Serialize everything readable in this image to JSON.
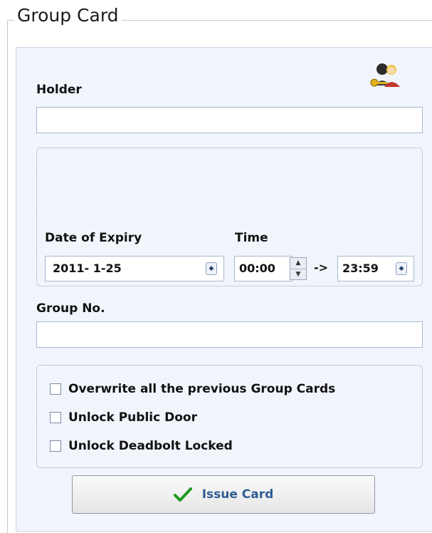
{
  "group": {
    "title": "Group Card"
  },
  "holder": {
    "label": "Holder",
    "value": ""
  },
  "expiry": {
    "date_label": "Date of Expiry",
    "time_label": "Time",
    "date_value": "2011- 1-25",
    "time_start": "00:00",
    "arrow": "->",
    "time_end": "23:59"
  },
  "group_no": {
    "label": "Group No.",
    "value": ""
  },
  "options": [
    {
      "label": "Overwrite all the previous Group Cards",
      "checked": false
    },
    {
      "label": "Unlock Public Door",
      "checked": false
    },
    {
      "label": "Unlock Deadbolt Locked",
      "checked": false
    }
  ],
  "issue_button": {
    "label": "Issue Card",
    "accent": "#1e9a1e"
  },
  "icons": {
    "group": "group-users-key-icon",
    "spin": "spin-icon",
    "check": "checkmark-icon"
  }
}
